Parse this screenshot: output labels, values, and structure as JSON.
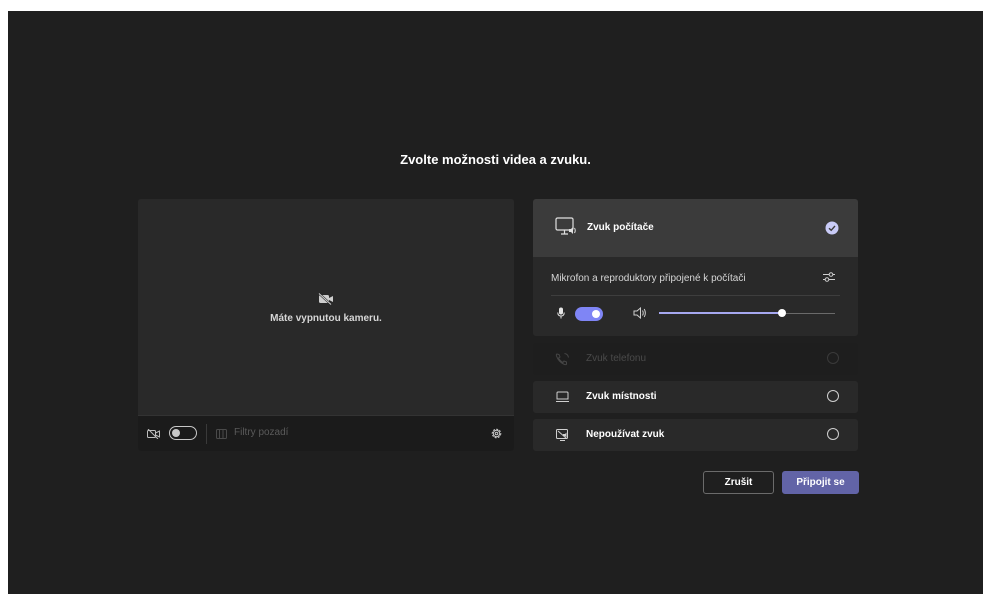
{
  "dialog": {
    "title": "Zvolte možnosti videa a zvuku."
  },
  "video": {
    "camera_off_text": "Máte vypnutou kameru.",
    "camera_toggle_on": false,
    "background_filters_label": "Filtry pozadí"
  },
  "audio_options": {
    "computer": {
      "label": "Zvuk počítače",
      "selected": true,
      "device_text": "Mikrofon a reproduktory připojené k počítači",
      "mic_toggle_on": true,
      "volume_level": 0.7
    },
    "phone": {
      "label": "Zvuk telefonu",
      "disabled": true
    },
    "room": {
      "label": "Zvuk místnosti"
    },
    "none": {
      "label": "Nepoužívat zvuk"
    }
  },
  "actions": {
    "cancel_label": "Zrušit",
    "join_label": "Připojit se"
  },
  "colors": {
    "background": "#1f1f1f",
    "panel": "#292929",
    "accent": "#6264a7",
    "toggle_accent": "#7f85f5"
  },
  "icons": {
    "camera_off": "camera-off-icon",
    "computer_audio": "computer-audio-icon",
    "check": "check-circle-icon",
    "device_settings": "sliders-icon",
    "mic": "microphone-icon",
    "speaker": "speaker-icon",
    "phone": "phone-icon",
    "room": "room-icon",
    "no_audio": "no-audio-icon",
    "filters": "background-filters-icon",
    "gear": "gear-icon"
  }
}
